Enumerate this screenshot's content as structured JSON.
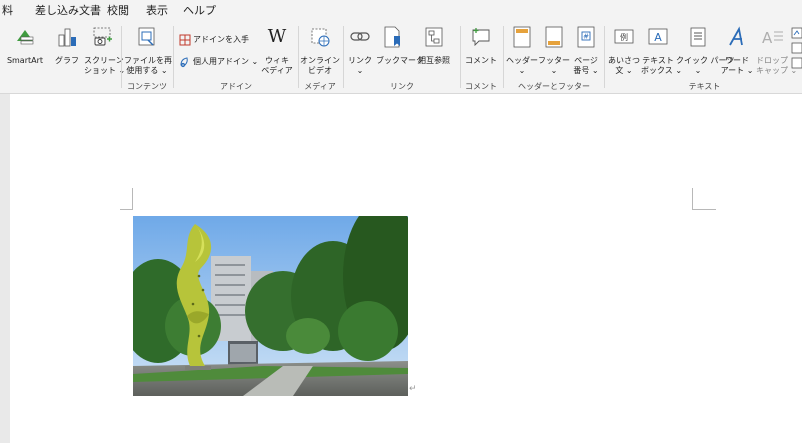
{
  "menu": {
    "items": [
      "料",
      "差し込み文書",
      "校閲",
      "表示",
      "ヘルプ"
    ]
  },
  "ribbon": {
    "smartart": "SmartArt",
    "graph": "グラフ",
    "screenshot": [
      "スクリーン",
      "ショット"
    ],
    "reuse_files": [
      "ファイルを再",
      "使用する"
    ],
    "get_addins": "アドインを入手",
    "personal_addins": "個人用アドイン",
    "wikipedia": [
      "ウィキ",
      "ペディア"
    ],
    "online_video": [
      "オンライン",
      "ビデオ"
    ],
    "link": "リンク",
    "bookmark": "ブックマーク",
    "cross_ref": "相互参照",
    "comment": "コメント",
    "header": "ヘッダー",
    "footer": "フッター",
    "page_number": [
      "ページ",
      "番号"
    ],
    "greeting": [
      "あいさつ",
      "文"
    ],
    "textbox": [
      "テキスト",
      "ボックス"
    ],
    "quick_parts": "クイック パーツ",
    "wordart": [
      "ワード",
      "アート"
    ],
    "dropcap": [
      "ドロップ",
      "キャップ"
    ],
    "groups": {
      "content": "コンテンツ",
      "addins": "アドイン",
      "media": "メディア",
      "links": "リンク",
      "comments": "コメント",
      "header_footer": "ヘッダーとフッター",
      "text": "テキスト"
    },
    "dropdown_glyph": "⌄"
  },
  "document": {
    "paragraph_mark": "↵"
  },
  "colors": {
    "ribbon_bg": "#f3f3f3",
    "accent_blue": "#2b6cb8",
    "accent_green": "#3f9b3f",
    "header_orange": "#e6a23c",
    "page_bg": "#ffffff",
    "canvas_bg": "#e9e9e9"
  }
}
